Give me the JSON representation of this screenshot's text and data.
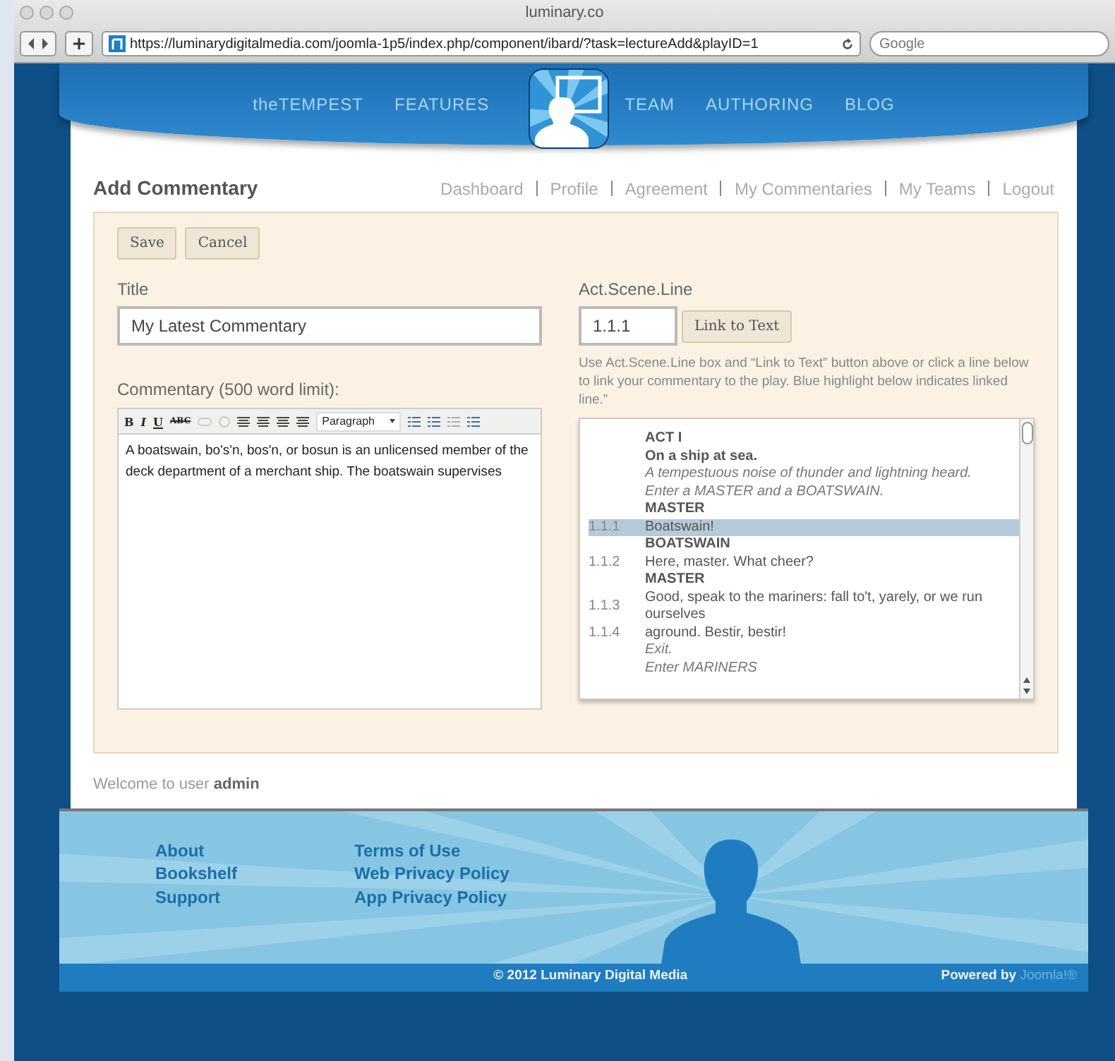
{
  "browser": {
    "title": "luminary.co",
    "url": "https://luminarydigitalmedia.com/joomla-1p5/index.php/component/ibard/?task=lectureAdd&playID=1",
    "search_placeholder": "Google"
  },
  "nav": {
    "left": [
      "theTEMPEST",
      "FEATURES"
    ],
    "right": [
      "TEAM",
      "AUTHORING",
      "BLOG"
    ]
  },
  "page_title": "Add Commentary",
  "user_links": [
    "Dashboard",
    "Profile",
    "Agreement",
    "My Commentaries",
    "My Teams",
    "Logout"
  ],
  "actions": [
    "Save",
    "Cancel"
  ],
  "title_field": {
    "label": "Title",
    "value": "My Latest Commentary"
  },
  "commentary": {
    "label": "Commentary (500 word limit):",
    "toolbar_text": [
      "B",
      "I",
      "U",
      "ABC"
    ],
    "format": "Paragraph",
    "text": "A boatswain, bo's'n, bos'n, or bosun is an unlicensed member of the deck department of a merchant ship. The boatswain supervises"
  },
  "asl": {
    "label": "Act.Scene.Line",
    "value": "1.1.1",
    "button": "Link to Text",
    "help": "Use Act.Scene.Line box and “Link to Text” button above or click a line below to link your commentary to the play. Blue highlight below indicates linked line.”"
  },
  "script": [
    {
      "kind": "heading",
      "text": "ACT I"
    },
    {
      "kind": "heading",
      "text": "On a ship at sea."
    },
    {
      "kind": "direction",
      "text": "A tempestuous noise of thunder and lightning heard."
    },
    {
      "kind": "direction",
      "text": "Enter a MASTER and a BOATSWAIN."
    },
    {
      "kind": "heading",
      "text": "MASTER"
    },
    {
      "kind": "line",
      "number": "1.1.1",
      "text": "Boatswain!",
      "selected": true
    },
    {
      "kind": "heading",
      "text": "BOATSWAIN"
    },
    {
      "kind": "line",
      "number": "1.1.2",
      "text": "Here, master. What cheer?",
      "selected": false
    },
    {
      "kind": "heading",
      "text": "MASTER"
    },
    {
      "kind": "line",
      "number": "1.1.3",
      "text": "Good, speak to the mariners: fall to't, yarely, or we run ourselves",
      "selected": false
    },
    {
      "kind": "line",
      "number": "1.1.4",
      "text": "aground. Bestir, bestir!",
      "selected": false
    },
    {
      "kind": "direction",
      "text": "Exit."
    },
    {
      "kind": "direction",
      "text": "Enter MARINERS"
    }
  ],
  "welcome": "Welcome to user **admin**",
  "footer": {
    "links_1": [
      "About",
      "Bookshelf",
      "Support"
    ],
    "links_2": [
      "Terms of Use",
      "Web Privacy Policy",
      "App Privacy Policy"
    ],
    "copyright": "© 2012 Luminary Digital Media",
    "powered_label": "Powered by",
    "powered_brand": "Joomla!®"
  }
}
